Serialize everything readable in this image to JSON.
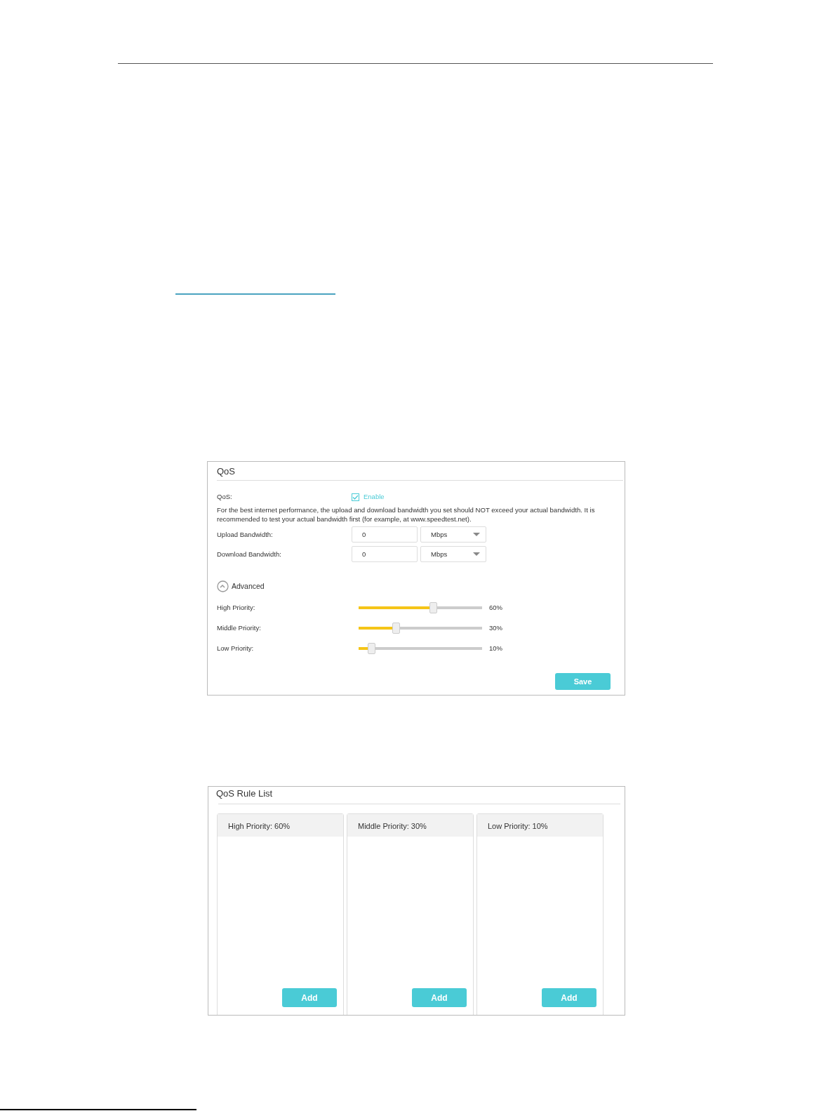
{
  "qos_panel": {
    "title": "QoS",
    "qos_label": "QoS:",
    "enable": {
      "label": "Enable",
      "checked": true
    },
    "description": "For the best internet performance, the upload and download bandwidth you set should NOT exceed your actual bandwidth. It is recommended to test your actual bandwidth first (for example, at www.speedtest.net).",
    "bandwidth": [
      {
        "label": "Upload Bandwidth:",
        "value": "0",
        "unit": "Mbps"
      },
      {
        "label": "Download Bandwidth:",
        "value": "0",
        "unit": "Mbps"
      }
    ],
    "advanced": {
      "label": "Advanced",
      "expanded": true
    },
    "priorities": [
      {
        "label": "High Priority:",
        "level": 0.6,
        "reading": "60%"
      },
      {
        "label": "Middle Priority:",
        "level": 0.3,
        "reading": "30%"
      },
      {
        "label": "Low Priority:",
        "level": 0.1,
        "reading": "10%"
      }
    ],
    "save_button": "Save"
  },
  "rule_list": {
    "title": "QoS Rule List",
    "columns": [
      {
        "title": "High Priority: 60%",
        "button": "Add"
      },
      {
        "title": "Middle Priority: 30%",
        "button": "Add"
      },
      {
        "title": "Low Priority: 10%",
        "button": "Add"
      }
    ]
  }
}
